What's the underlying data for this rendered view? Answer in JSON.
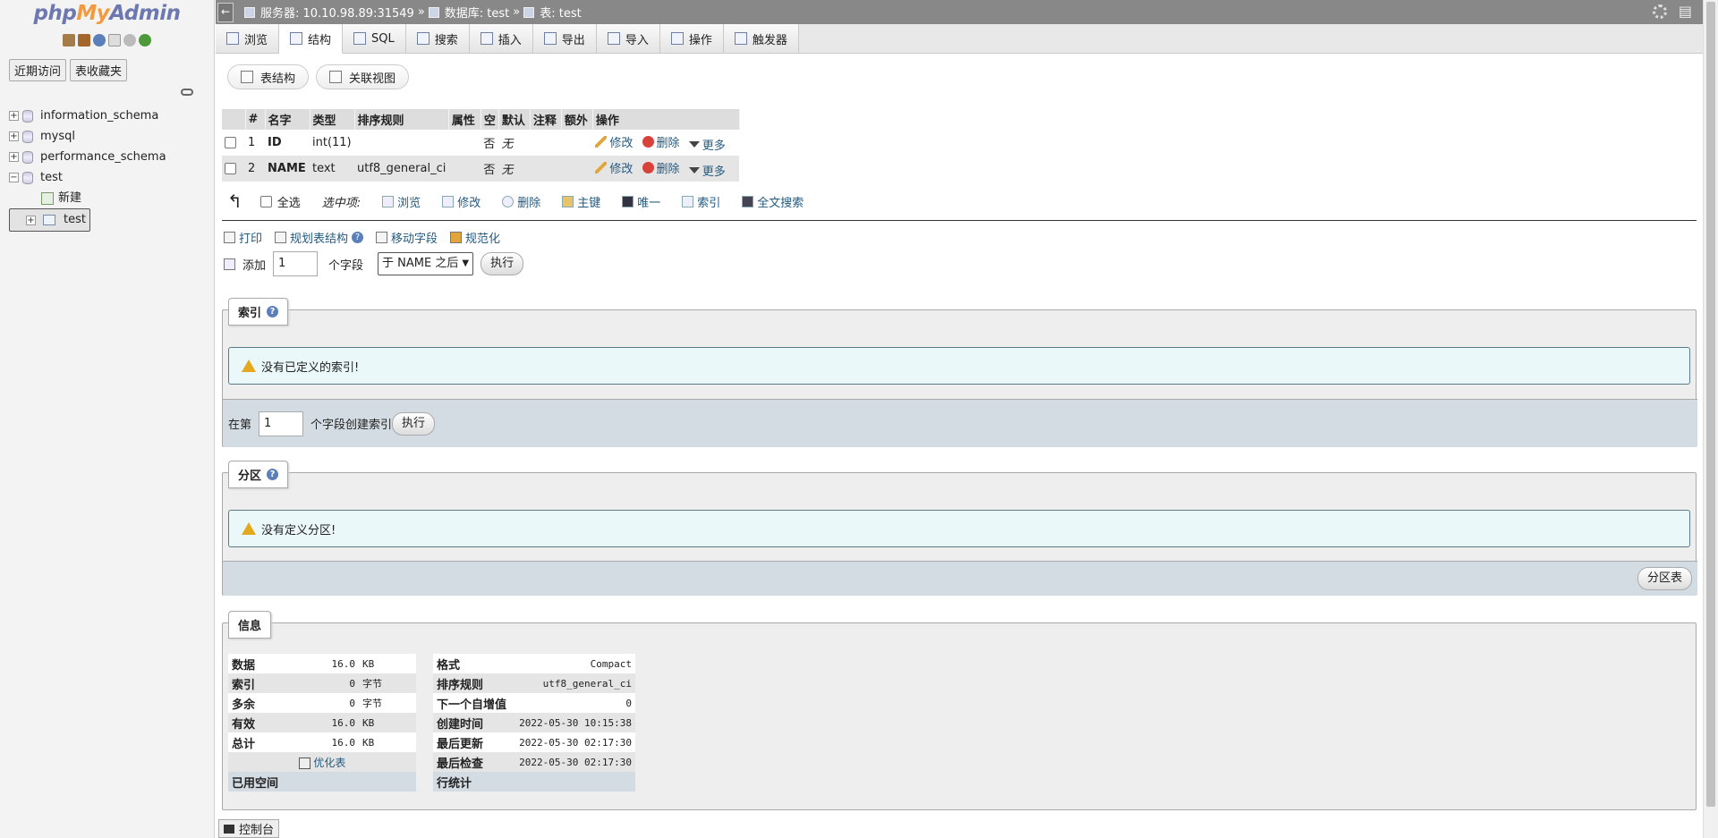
{
  "sidebar": {
    "logo": {
      "php": "php",
      "my": "My",
      "admin": "Admin"
    },
    "tabs": [
      "近期访问",
      "表收藏夹"
    ],
    "tree": [
      {
        "label": "information_schema"
      },
      {
        "label": "mysql"
      },
      {
        "label": "performance_schema"
      },
      {
        "label": "test"
      },
      {
        "label": "新建"
      },
      {
        "label": "test"
      }
    ]
  },
  "topbar": {
    "server": "服务器: 10.10.98.89:31549",
    "sep1": "»",
    "database": "数据库: test",
    "sep2": "»",
    "table": "表: test"
  },
  "tabs": [
    "浏览",
    "结构",
    "SQL",
    "搜索",
    "插入",
    "导出",
    "导入",
    "操作",
    "触发器"
  ],
  "subtabs": [
    "表结构",
    "关联视图"
  ],
  "structure": {
    "headers": [
      "#",
      "名字",
      "类型",
      "排序规则",
      "属性",
      "空",
      "默认",
      "注释",
      "额外",
      "操作"
    ],
    "rows": [
      {
        "num": "1",
        "name": "ID",
        "type": "int(11)",
        "collation": "",
        "attr": "",
        "null": "否",
        "default": "无",
        "comment": "",
        "extra": ""
      },
      {
        "num": "2",
        "name": "NAME",
        "type": "text",
        "collation": "utf8_general_ci",
        "attr": "",
        "null": "否",
        "default": "无",
        "comment": "",
        "extra": ""
      }
    ],
    "actions": {
      "edit": "修改",
      "drop": "删除",
      "more": "更多"
    }
  },
  "bulk": {
    "select_all": "全选",
    "with_selected": "选中项:",
    "items": [
      "浏览",
      "修改",
      "删除",
      "主键",
      "唯一",
      "索引",
      "全文搜索"
    ]
  },
  "tools": {
    "print": "打印",
    "propose": "规划表结构",
    "move": "移动字段",
    "normalize": "规范化"
  },
  "add": {
    "label": "添加",
    "count": "1",
    "unit": "个字段",
    "position": "于 NAME 之后",
    "go": "执行"
  },
  "indexes": {
    "legend": "索引",
    "notice": "没有已定义的索引!",
    "prefix": "在第",
    "count": "1",
    "suffix": "个字段创建索引",
    "go": "执行"
  },
  "partitions": {
    "legend": "分区",
    "notice": "没有定义分区!",
    "button": "分区表"
  },
  "info": {
    "legend": "信息",
    "space": [
      {
        "k": "数据",
        "v": "16.0",
        "u": "KB"
      },
      {
        "k": "索引",
        "v": "0",
        "u": "字节"
      },
      {
        "k": "多余",
        "v": "0",
        "u": "字节"
      },
      {
        "k": "有效",
        "v": "16.0",
        "u": "KB"
      },
      {
        "k": "总计",
        "v": "16.0",
        "u": "KB"
      }
    ],
    "optimize": "优化表",
    "space_footer": "已用空间",
    "stats": [
      {
        "k": "格式",
        "v": "Compact"
      },
      {
        "k": "排序规则",
        "v": "utf8_general_ci"
      },
      {
        "k": "下一个自增值",
        "v": "0"
      },
      {
        "k": "创建时间",
        "v": "2022-05-30 10:15:38"
      },
      {
        "k": "最后更新",
        "v": "2022-05-30 02:17:30"
      },
      {
        "k": "最后检查",
        "v": "2022-05-30 02:17:30"
      }
    ],
    "stats_footer": "行统计"
  },
  "console": "控制台"
}
